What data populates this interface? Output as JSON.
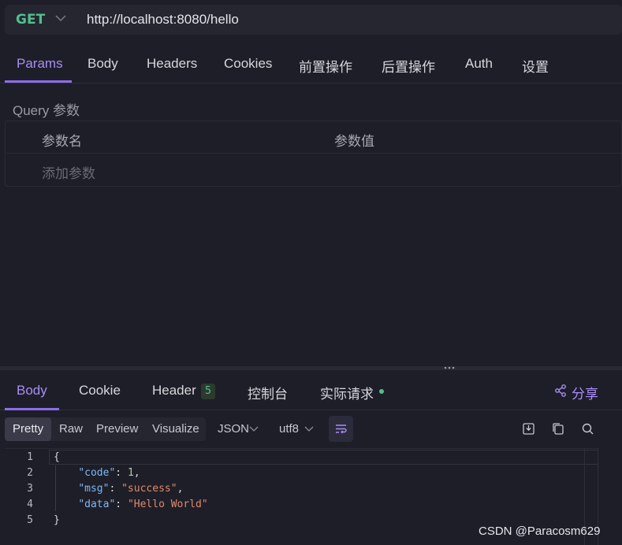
{
  "request": {
    "method": "GET",
    "url": "http://localhost:8080/hello",
    "tabs": [
      "Params",
      "Body",
      "Headers",
      "Cookies",
      "前置操作",
      "后置操作",
      "Auth",
      "设置"
    ],
    "active_tab": "Params",
    "query_label": "Query 参数",
    "param_columns": [
      "参数名",
      "参数值"
    ],
    "add_param_placeholder": "添加参数"
  },
  "response": {
    "tabs": [
      "Body",
      "Cookie",
      "Header",
      "控制台",
      "实际请求"
    ],
    "active_tab": "Body",
    "header_count": "5",
    "share_label": "分享",
    "view_modes": [
      "Pretty",
      "Raw",
      "Preview",
      "Visualize"
    ],
    "active_view": "Pretty",
    "format": "JSON",
    "encoding": "utf8",
    "line_numbers": [
      "1",
      "2",
      "3",
      "4",
      "5"
    ],
    "body": {
      "open": "{",
      "code_key": "\"code\"",
      "code_val": "1",
      "msg_key": "\"msg\"",
      "msg_val": "\"success\"",
      "data_key": "\"data\"",
      "data_val": "\"Hello World\"",
      "close": "}"
    }
  },
  "watermark": "CSDN @Paracosm629",
  "colors": {
    "accent": "#8b6fe8",
    "method_get": "#4fc08d",
    "string": "#e08a6b",
    "key": "#7fb8f5"
  }
}
